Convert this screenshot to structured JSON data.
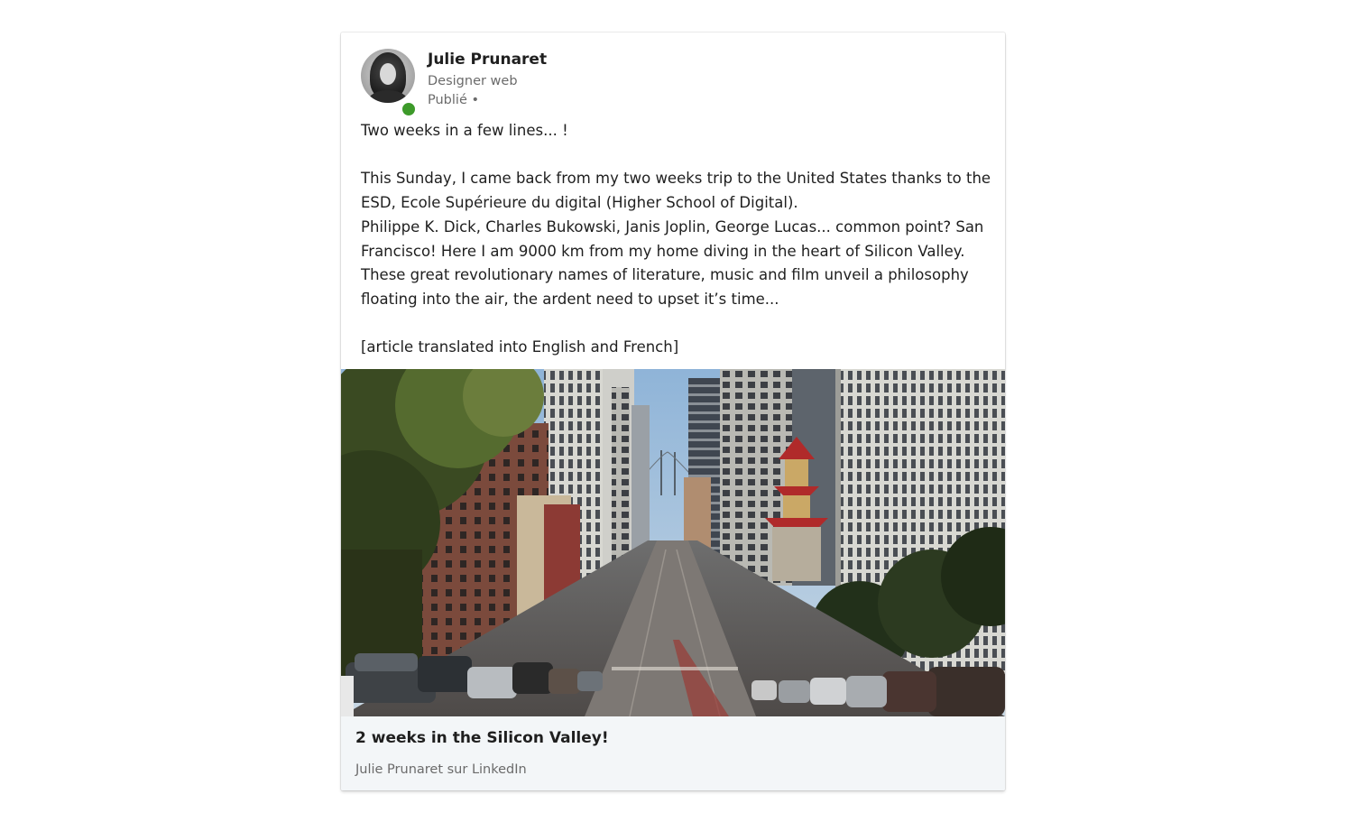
{
  "post": {
    "author": {
      "name": "Julie Prunaret",
      "headline": "Designer web",
      "published": "Publié •",
      "status_color": "#3d9a2a"
    },
    "text_lines": [
      "Two weeks in a few lines... !",
      "",
      "This Sunday, I came back from my two weeks trip to the United States thanks to the",
      "ESD, Ecole Supérieure du digital (Higher School of Digital).",
      "Philippe K. Dick, Charles Bukowski, Janis Joplin, George Lucas... common point? San",
      "Francisco! Here I am 9000 km from my home diving in the heart of Silicon Valley.",
      "These great revolutionary names of literature, music and film unveil a philosophy",
      "floating into the air, the ardent need to upset it’s time...",
      "",
      "[article translated into English and French]"
    ],
    "article": {
      "title": "2 weeks in the Silicon Valley!",
      "source": "Julie Prunaret sur LinkedIn"
    }
  }
}
